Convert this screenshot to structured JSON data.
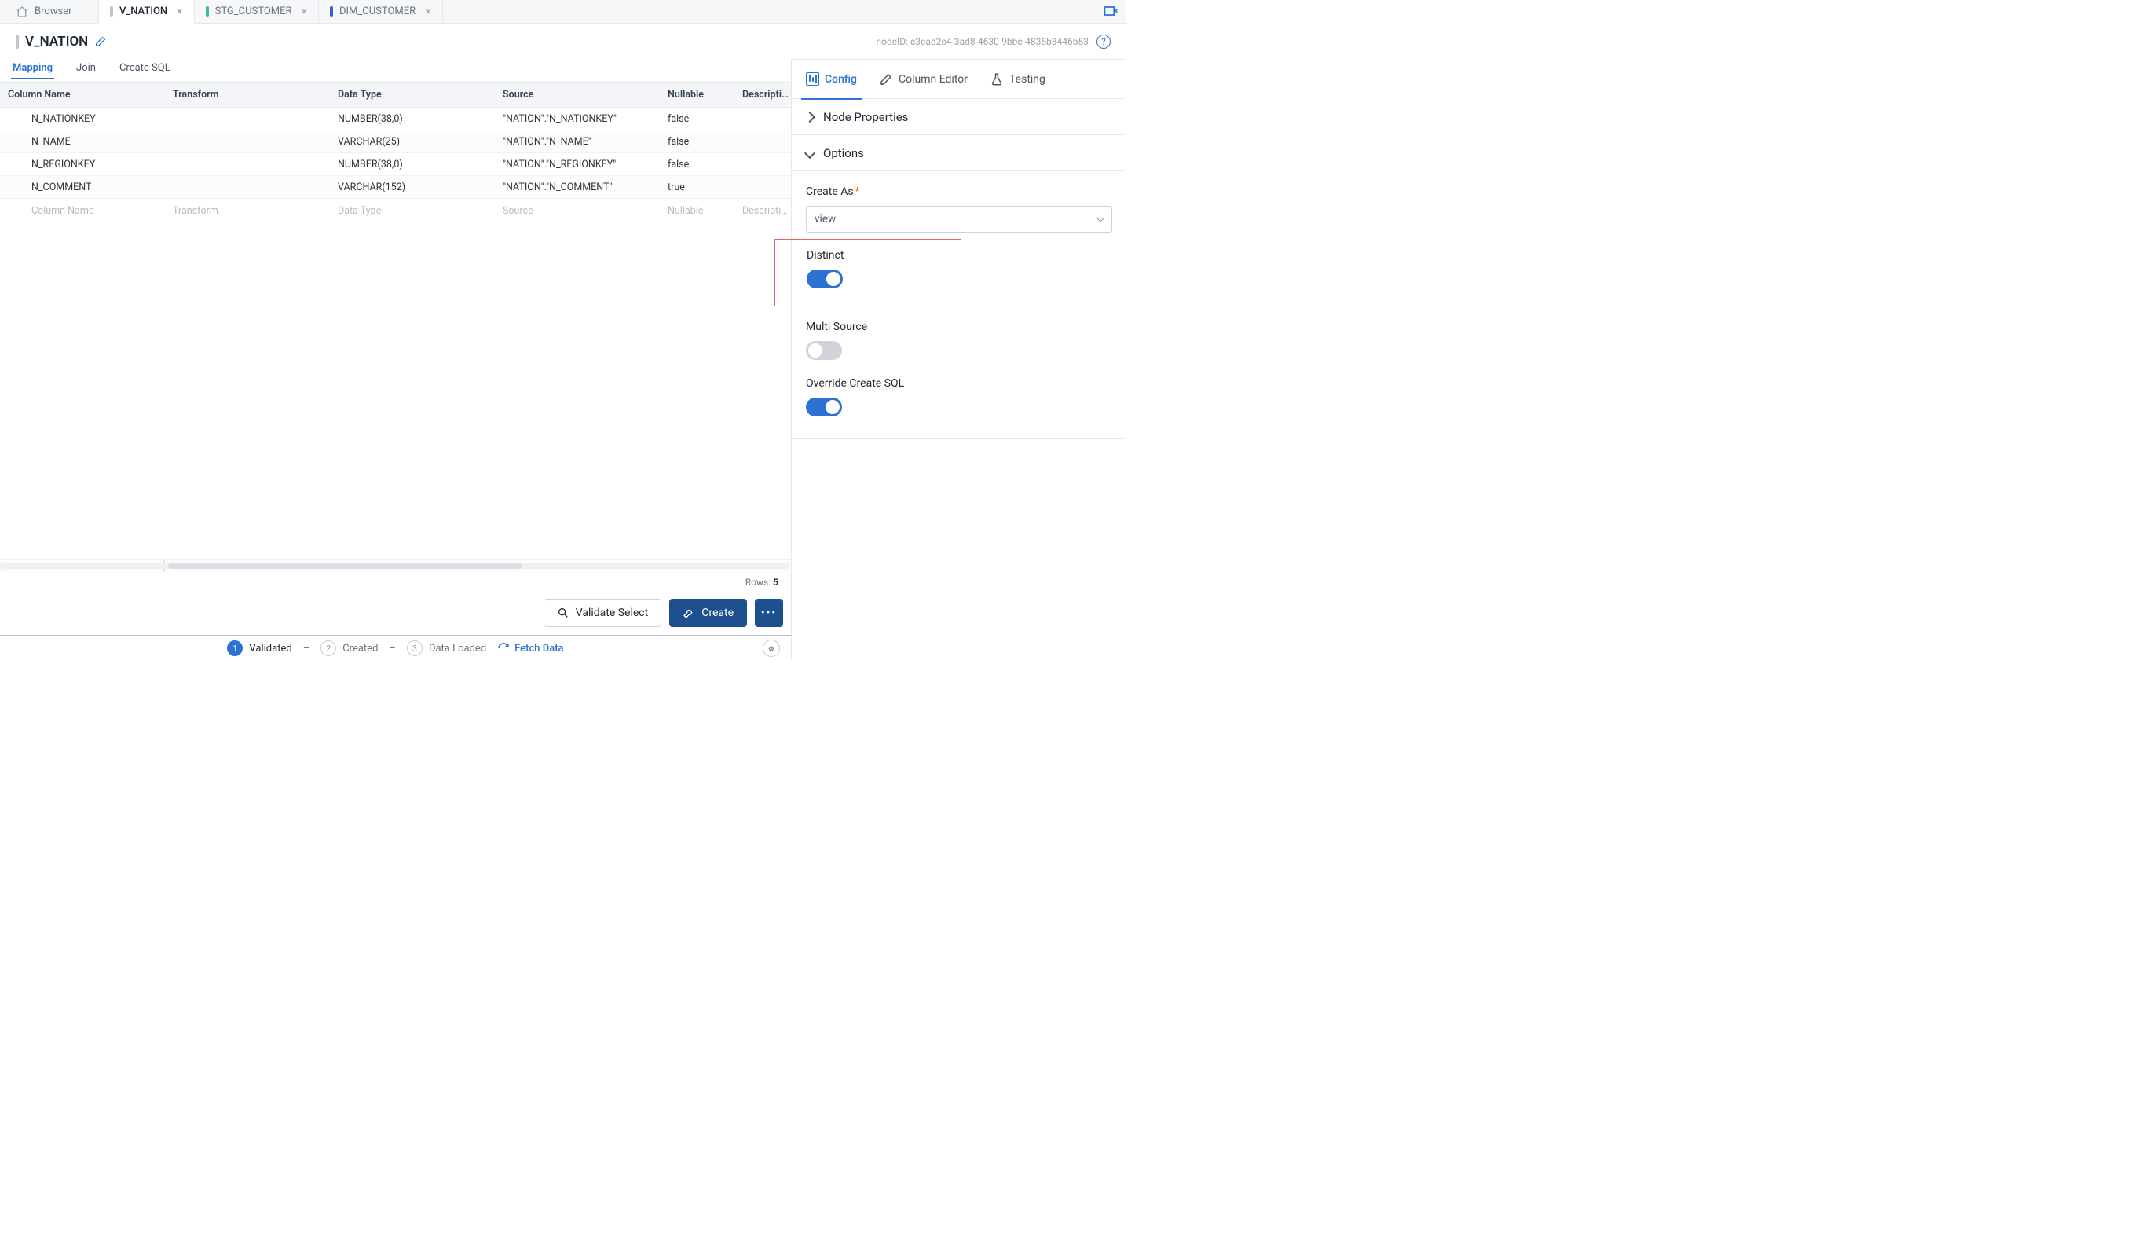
{
  "topbar": {
    "browser_label": "Browser",
    "tabs": [
      {
        "label": "V_NATION",
        "color": "#bfc3ca",
        "active": true
      },
      {
        "label": "STG_CUSTOMER",
        "color": "#3bbf86",
        "active": false
      },
      {
        "label": "DIM_CUSTOMER",
        "color": "#3b5bd9",
        "active": false
      }
    ]
  },
  "header": {
    "title": "V_NATION",
    "node_id_label": "nodeID: c3ead2c4-3ad8-4630-9bbe-4835b3446b53"
  },
  "subtabs": {
    "mapping": "Mapping",
    "join": "Join",
    "create_sql": "Create SQL",
    "active": "mapping"
  },
  "table": {
    "columns": {
      "name": "Column Name",
      "transform": "Transform",
      "datatype": "Data Type",
      "source": "Source",
      "nullable": "Nullable",
      "description": "Description"
    },
    "placeholder": {
      "name": "Column Name",
      "transform": "Transform",
      "datatype": "Data Type",
      "source": "Source",
      "nullable": "Nullable",
      "description": "Description"
    },
    "rows": [
      {
        "name": "N_NATIONKEY",
        "transform": "",
        "datatype": "NUMBER(38,0)",
        "source": "\"NATION\".\"N_NATIONKEY\"",
        "nullable": "false",
        "description": ""
      },
      {
        "name": "N_NAME",
        "transform": "",
        "datatype": "VARCHAR(25)",
        "source": "\"NATION\".\"N_NAME\"",
        "nullable": "false",
        "description": ""
      },
      {
        "name": "N_REGIONKEY",
        "transform": "",
        "datatype": "NUMBER(38,0)",
        "source": "\"NATION\".\"N_REGIONKEY\"",
        "nullable": "false",
        "description": ""
      },
      {
        "name": "N_COMMENT",
        "transform": "",
        "datatype": "VARCHAR(152)",
        "source": "\"NATION\".\"N_COMMENT\"",
        "nullable": "true",
        "description": ""
      }
    ]
  },
  "footer": {
    "rows_label": "Rows:",
    "rows_count": "5",
    "validate_select": "Validate Select",
    "create": "Create"
  },
  "steps": {
    "s1": "Validated",
    "s2": "Created",
    "s3": "Data Loaded",
    "fetch": "Fetch Data"
  },
  "side": {
    "tabs": {
      "config": "Config",
      "column_editor": "Column Editor",
      "testing": "Testing"
    },
    "sections": {
      "node_properties": "Node Properties",
      "options": "Options"
    },
    "form": {
      "create_as_label": "Create As",
      "create_as_value": "view",
      "distinct_label": "Distinct",
      "distinct_on": true,
      "multi_source_label": "Multi Source",
      "multi_source_on": false,
      "override_sql_label": "Override Create SQL",
      "override_sql_on": true
    }
  }
}
